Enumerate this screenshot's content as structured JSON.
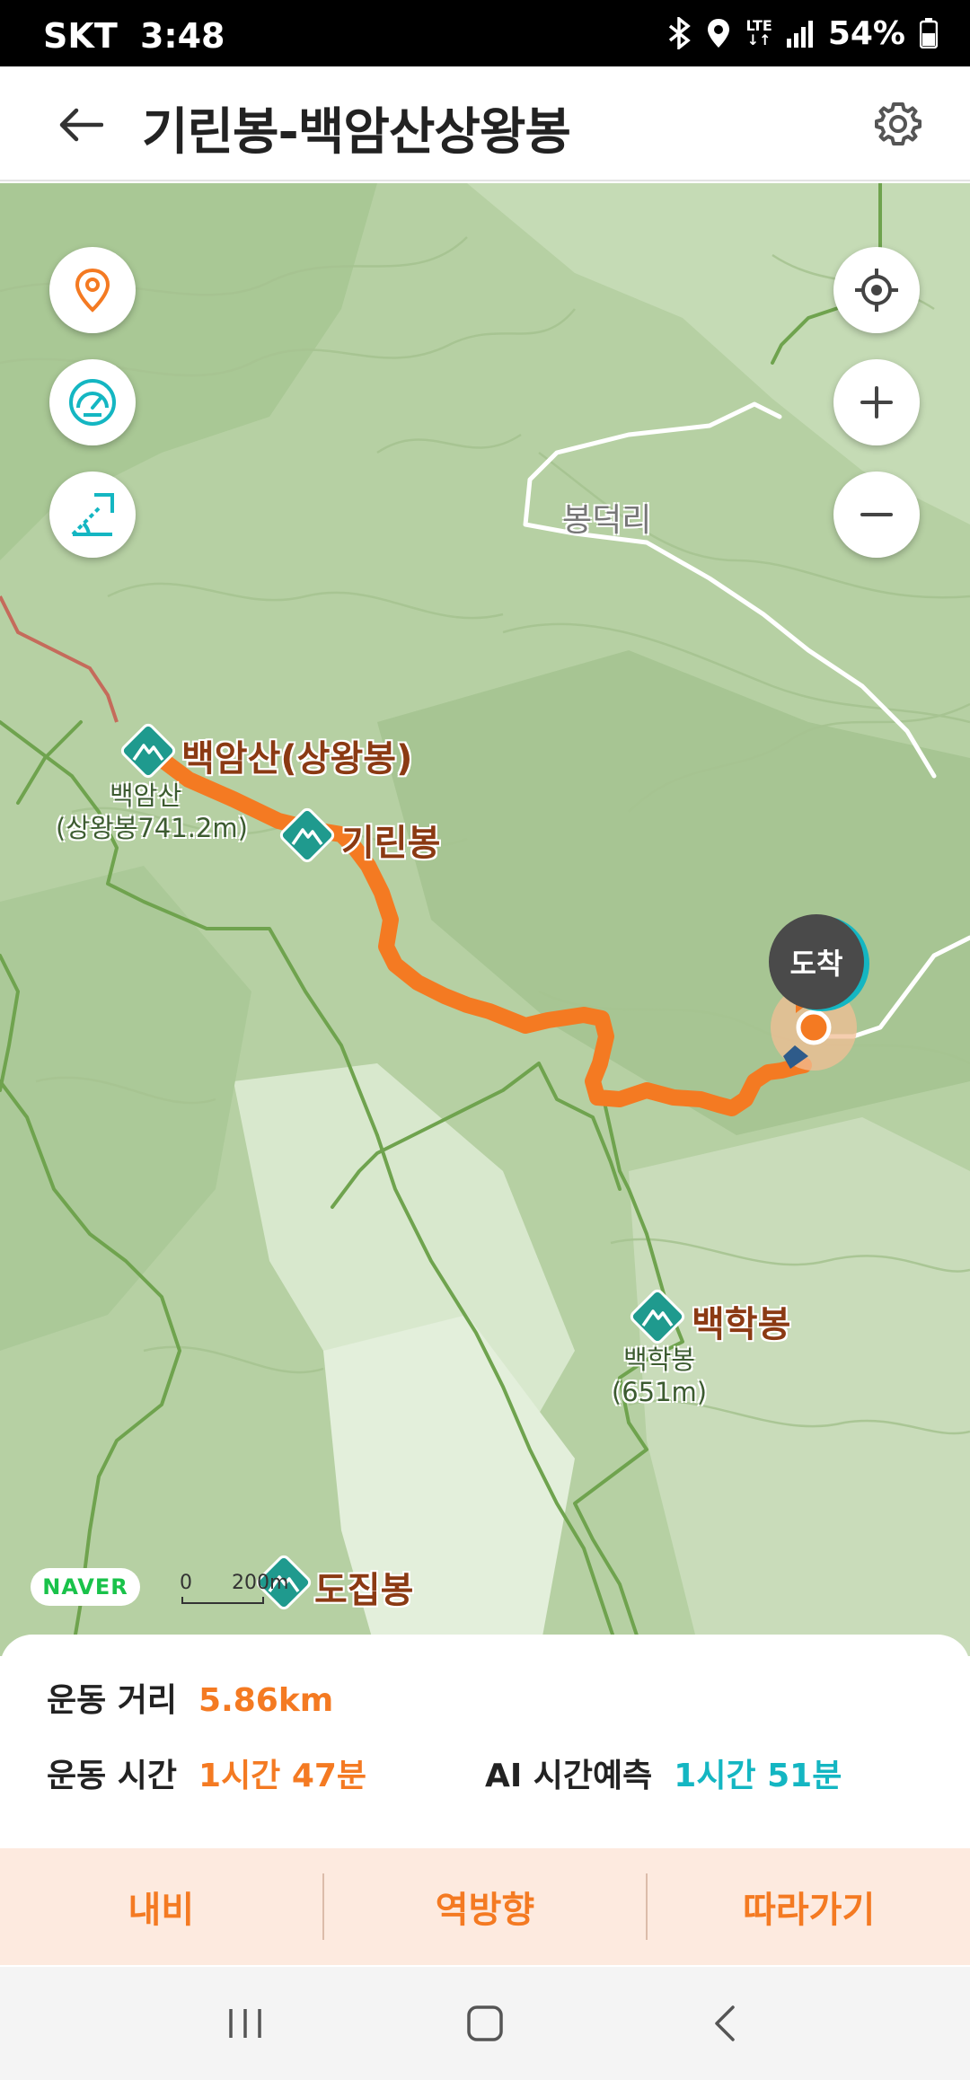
{
  "status_bar": {
    "carrier": "SKT",
    "time": "3:48",
    "network": "LTE",
    "battery": "54%"
  },
  "header": {
    "title": "기린봉-백암산상왕봉"
  },
  "map": {
    "village_label": "봉덕리",
    "peaks": [
      {
        "name": "백암산(상왕봉)",
        "sub1": "백암산",
        "sub2": "(상왕봉741.2m)"
      },
      {
        "name": "기린봉"
      },
      {
        "name": "백학봉",
        "sub1": "백학봉",
        "sub2": "(651m)"
      },
      {
        "name": "도집봉"
      }
    ],
    "arrival_label": "도착",
    "logo": "NAVER",
    "scale": {
      "start": "0",
      "end": "200m"
    }
  },
  "stats": {
    "distance_label": "운동 거리",
    "distance_value": "5.86km",
    "time_label": "운동 시간",
    "time_value": "1시간 47분",
    "ai_label": "AI 시간예측",
    "ai_value": "1시간 51분"
  },
  "actions": {
    "nav": "내비",
    "reverse": "역방향",
    "follow": "따라가기"
  },
  "colors": {
    "route": "#f47a22",
    "accent_teal": "#14b6c2",
    "peak_label": "#8b3a13"
  }
}
